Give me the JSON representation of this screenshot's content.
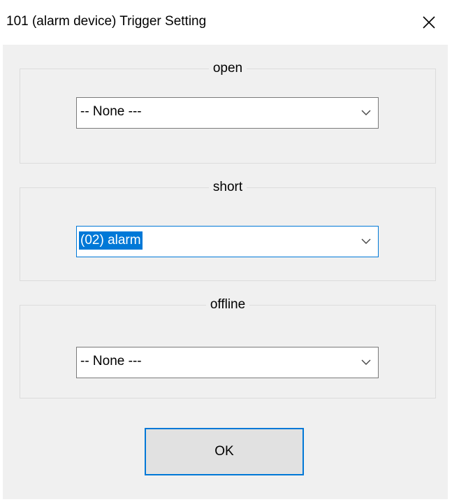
{
  "window": {
    "title": "101 (alarm device) Trigger Setting"
  },
  "groups": [
    {
      "label": "open",
      "selected_value": "-- None ---",
      "focused": false
    },
    {
      "label": "short",
      "selected_value": "(02) alarm",
      "focused": true
    },
    {
      "label": "offline",
      "selected_value": "-- None ---",
      "focused": false
    }
  ],
  "buttons": {
    "ok_label": "OK"
  },
  "colors": {
    "accent": "#0078d7",
    "client_bg": "#f0f0f0",
    "button_bg": "#e1e1e1"
  },
  "icons": {
    "close": "close-icon",
    "dropdown": "chevron-down-icon"
  }
}
